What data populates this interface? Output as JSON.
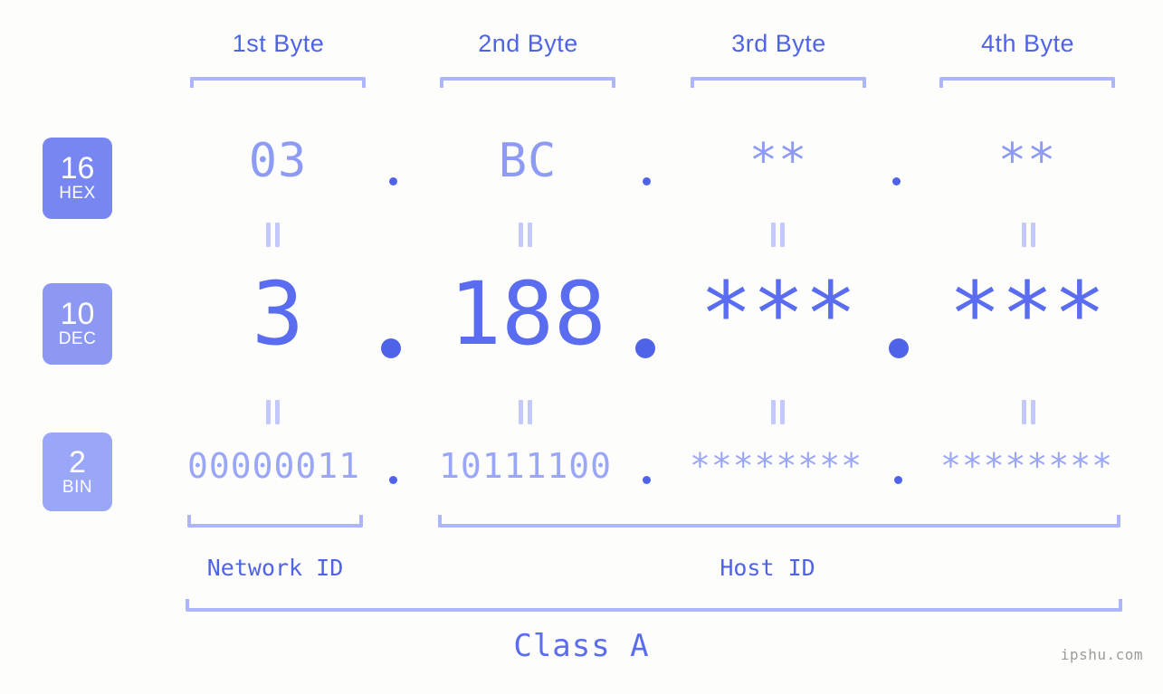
{
  "background_color": "#fdfefb",
  "accent_color": "#4f63e8",
  "muted_accent_color": "#aeb6fb",
  "headers": {
    "byte1": "1st Byte",
    "byte2": "2nd Byte",
    "byte3": "3rd Byte",
    "byte4": "4th Byte"
  },
  "radix_badges": [
    {
      "number": "16",
      "unit": "HEX",
      "color": "#7886f2"
    },
    {
      "number": "10",
      "unit": "DEC",
      "color": "#8d98f3"
    },
    {
      "number": "2",
      "unit": "BIN",
      "color": "#9aa6f8"
    }
  ],
  "rows": {
    "hex": {
      "label": "HEX",
      "base": "16",
      "values": [
        "03",
        "BC",
        "**",
        "**"
      ],
      "separator": "."
    },
    "dec": {
      "label": "DEC",
      "base": "10",
      "values": [
        "3",
        "188",
        "***",
        "***"
      ],
      "separator": "."
    },
    "bin": {
      "label": "BIN",
      "base": "2",
      "values": [
        "00000011",
        "10111100",
        "********",
        "********"
      ],
      "separator": "."
    }
  },
  "equals_symbol": "=",
  "segments": {
    "network_id": "Network ID",
    "host_id": "Host ID"
  },
  "class_label": "Class A",
  "watermark": "ipshu.com"
}
